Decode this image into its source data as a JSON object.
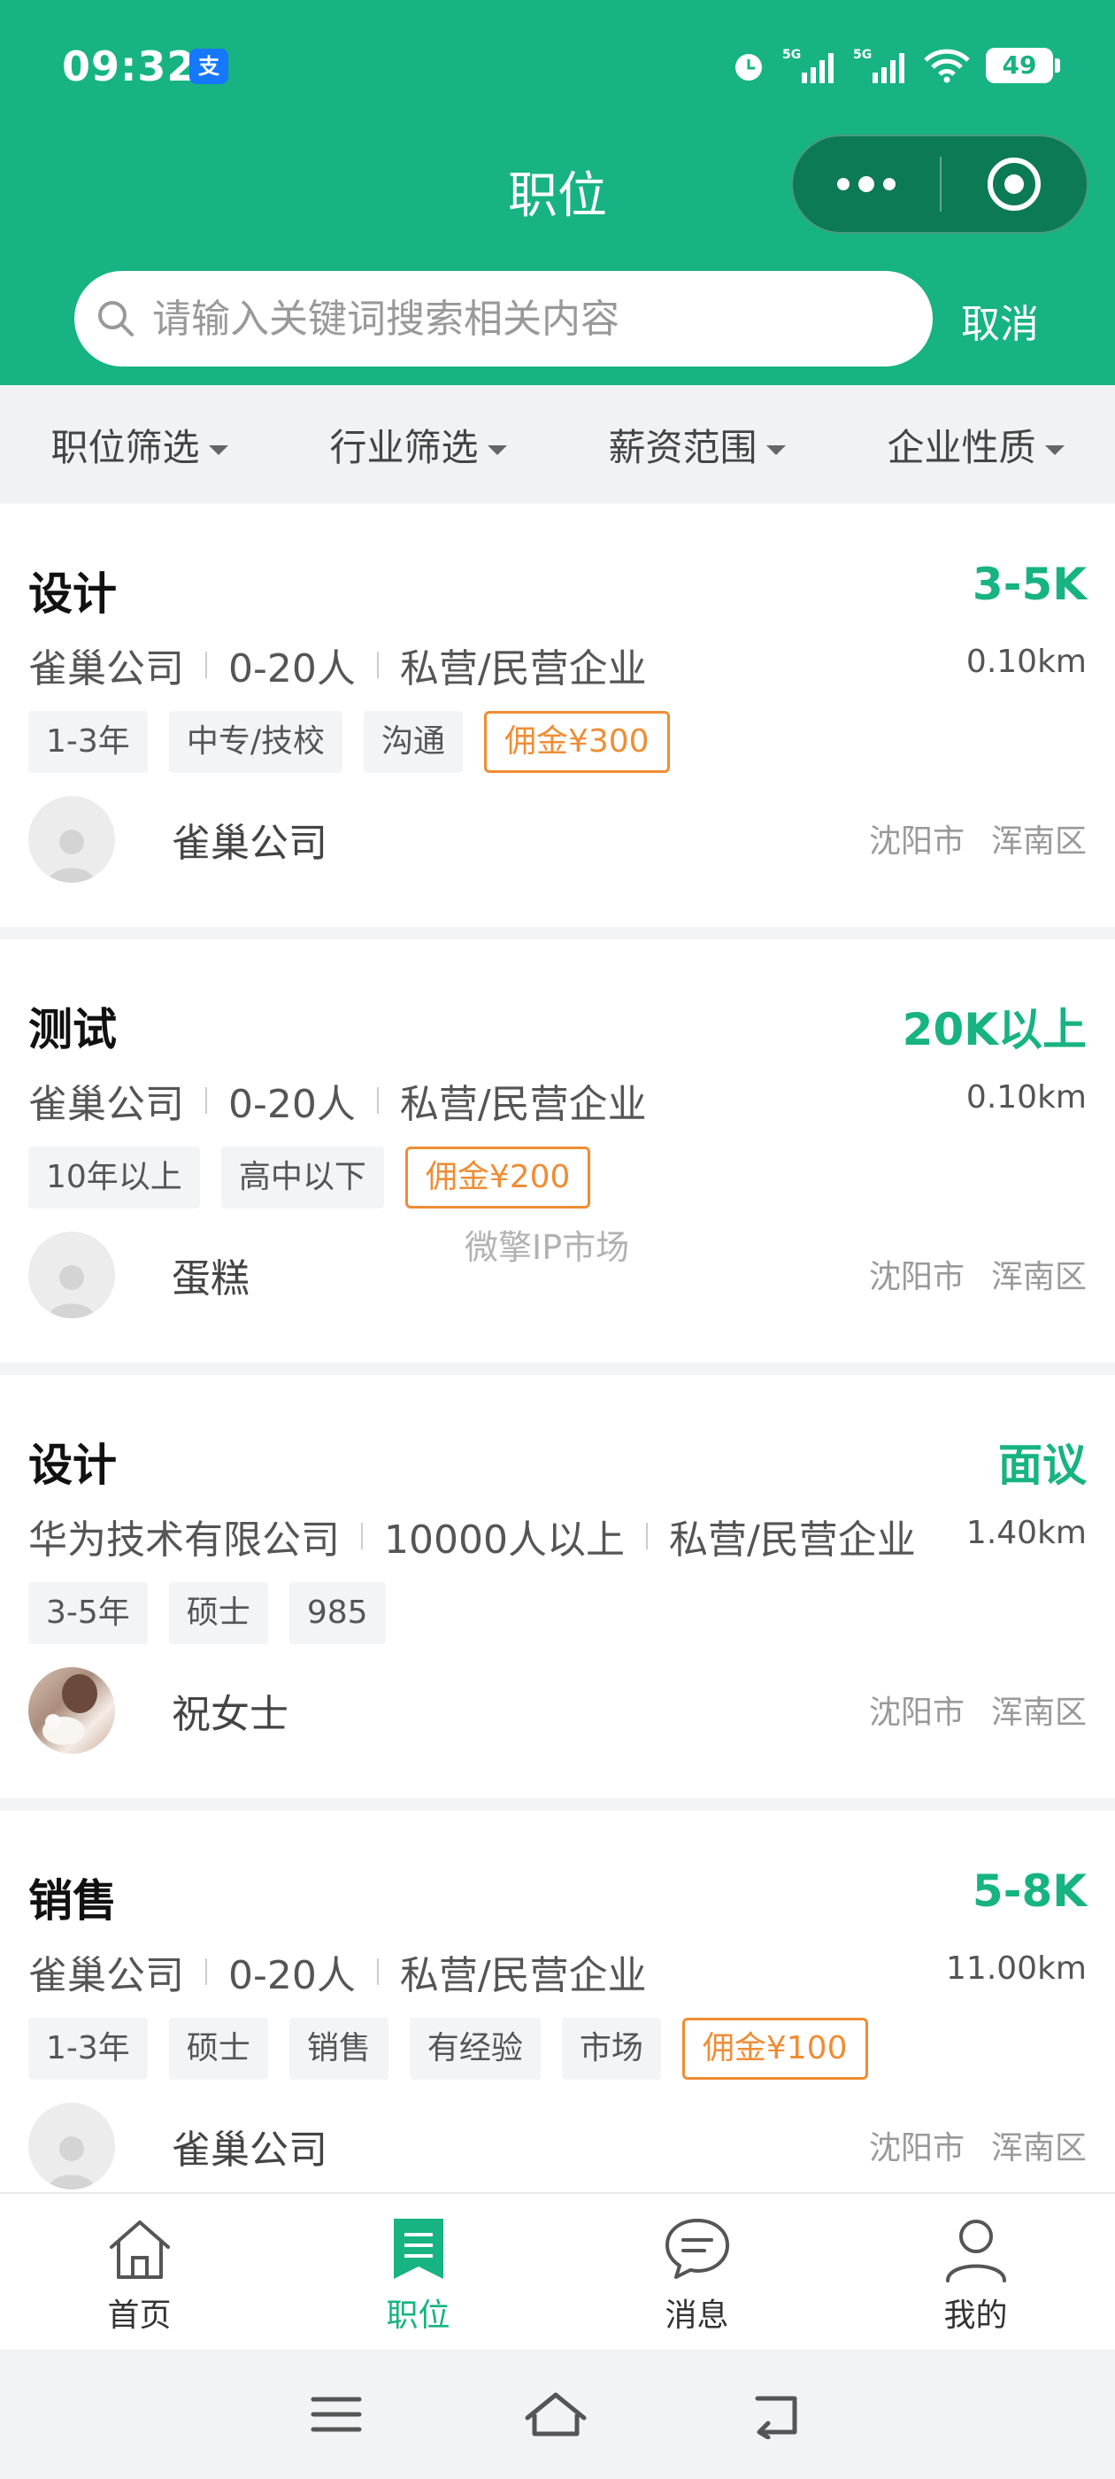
{
  "status_bar": {
    "time": "09:32",
    "app_badge": "支",
    "battery": "49",
    "signal_label": "5G"
  },
  "header": {
    "title": "职位",
    "search_placeholder": "请输入关键词搜索相关内容",
    "cancel_label": "取消"
  },
  "filters": [
    {
      "label": "职位筛选"
    },
    {
      "label": "行业筛选"
    },
    {
      "label": "薪资范围"
    },
    {
      "label": "企业性质"
    }
  ],
  "jobs": [
    {
      "title": "设计",
      "salary": "3-5K",
      "company": "雀巢公司",
      "size": "0-20人",
      "type": "私营/民营企业",
      "distance": "0.10km",
      "tags": [
        "1-3年",
        "中专/技校",
        "沟通"
      ],
      "commission": "佣金¥300",
      "recruiter": "雀巢公司",
      "city": "沈阳市",
      "district": "浑南区"
    },
    {
      "title": "测试",
      "salary": "20K以上",
      "company": "雀巢公司",
      "size": "0-20人",
      "type": "私营/民营企业",
      "distance": "0.10km",
      "tags": [
        "10年以上",
        "高中以下"
      ],
      "commission": "佣金¥200",
      "recruiter": "蛋糕",
      "city": "沈阳市",
      "district": "浑南区"
    },
    {
      "title": "设计",
      "salary": "面议",
      "company": "华为技术有限公司",
      "size": "10000人以上",
      "type": "私营/民营企业",
      "distance": "1.40km",
      "tags": [
        "3-5年",
        "硕士",
        "985"
      ],
      "recruiter": "祝女士",
      "city": "沈阳市",
      "district": "浑南区"
    },
    {
      "title": "销售",
      "salary": "5-8K",
      "company": "雀巢公司",
      "size": "0-20人",
      "type": "私营/民营企业",
      "distance": "11.00km",
      "tags": [
        "1-3年",
        "硕士",
        "销售",
        "有经验",
        "市场"
      ],
      "commission": "佣金¥100",
      "recruiter": "雀巢公司",
      "city": "沈阳市",
      "district": "浑南区"
    }
  ],
  "watermark": "微擎IP市场",
  "tabbar": [
    {
      "label": "首页",
      "icon": "home-icon"
    },
    {
      "label": "职位",
      "icon": "jobs-icon"
    },
    {
      "label": "消息",
      "icon": "message-icon"
    },
    {
      "label": "我的",
      "icon": "profile-icon"
    }
  ],
  "colors": {
    "brand": "#17b382",
    "commission": "#ef8d35"
  }
}
